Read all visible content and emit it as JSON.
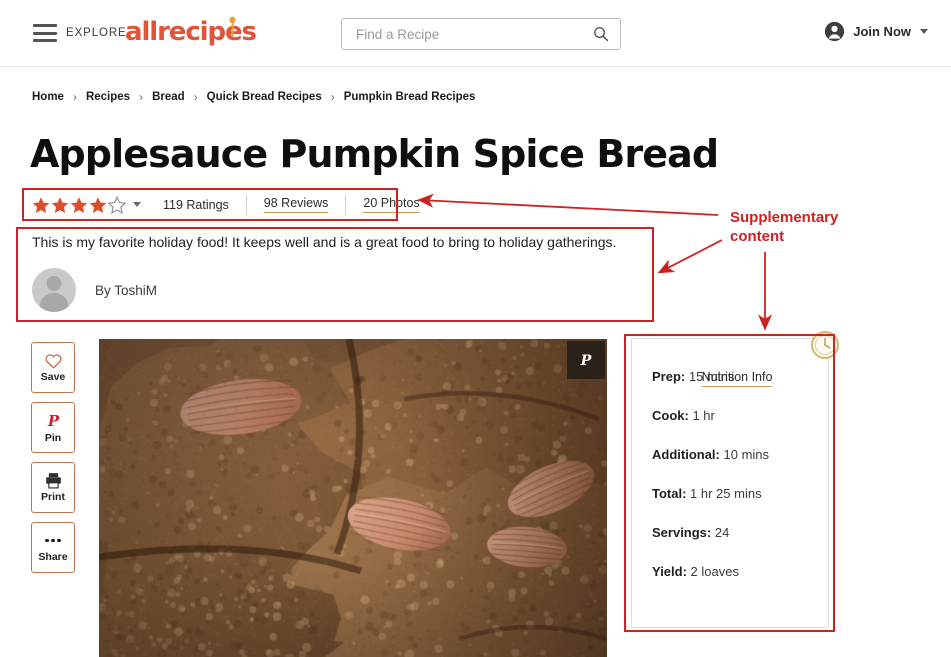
{
  "header": {
    "menu_label": "EXPLORE",
    "logo_text": "allrecipes",
    "search_placeholder": "Find a Recipe",
    "search_value": "",
    "account_label": "Join Now"
  },
  "breadcrumb": {
    "items": [
      "Home",
      "Recipes",
      "Bread",
      "Quick Bread Recipes",
      "Pumpkin Bread Recipes"
    ],
    "separator": "›"
  },
  "recipe": {
    "title": "Applesauce Pumpkin Spice Bread",
    "rating": {
      "stars_filled": 4,
      "stars_total": 5,
      "ratings_label": "119 Ratings",
      "reviews_label": "98 Reviews",
      "photos_label": "20 Photos"
    },
    "description": "This is my favorite holiday food! It keeps well and is a great food to bring to holiday gatherings.",
    "author": "By ToshiM"
  },
  "actions": [
    {
      "label": "Save",
      "icon": "heart-icon"
    },
    {
      "label": "Pin",
      "icon": "pinterest-icon"
    },
    {
      "label": "Print",
      "icon": "printer-icon"
    },
    {
      "label": "Share",
      "icon": "ellipsis-icon"
    }
  ],
  "hero": {
    "pin_button_icon": "pinterest-icon"
  },
  "meta_card": {
    "icon": "clock-icon",
    "items": [
      {
        "label": "Prep:",
        "value": "15 mins"
      },
      {
        "label": "Cook:",
        "value": "1 hr"
      },
      {
        "label": "Additional:",
        "value": "10 mins"
      },
      {
        "label": "Total:",
        "value": "1 hr 25 mins"
      },
      {
        "label": "Servings:",
        "value": "24"
      },
      {
        "label": "Yield:",
        "value": "2 loaves"
      }
    ],
    "nutrition_link": "Nutrition Info"
  },
  "annotation": {
    "label": "Supplementary content",
    "color": "#cc2222"
  },
  "colors": {
    "brand": "#e0553a",
    "star": "#d94f2b",
    "accent_underline": "#c79b57",
    "action_border": "#c2734f",
    "annotation": "#cc2222"
  }
}
